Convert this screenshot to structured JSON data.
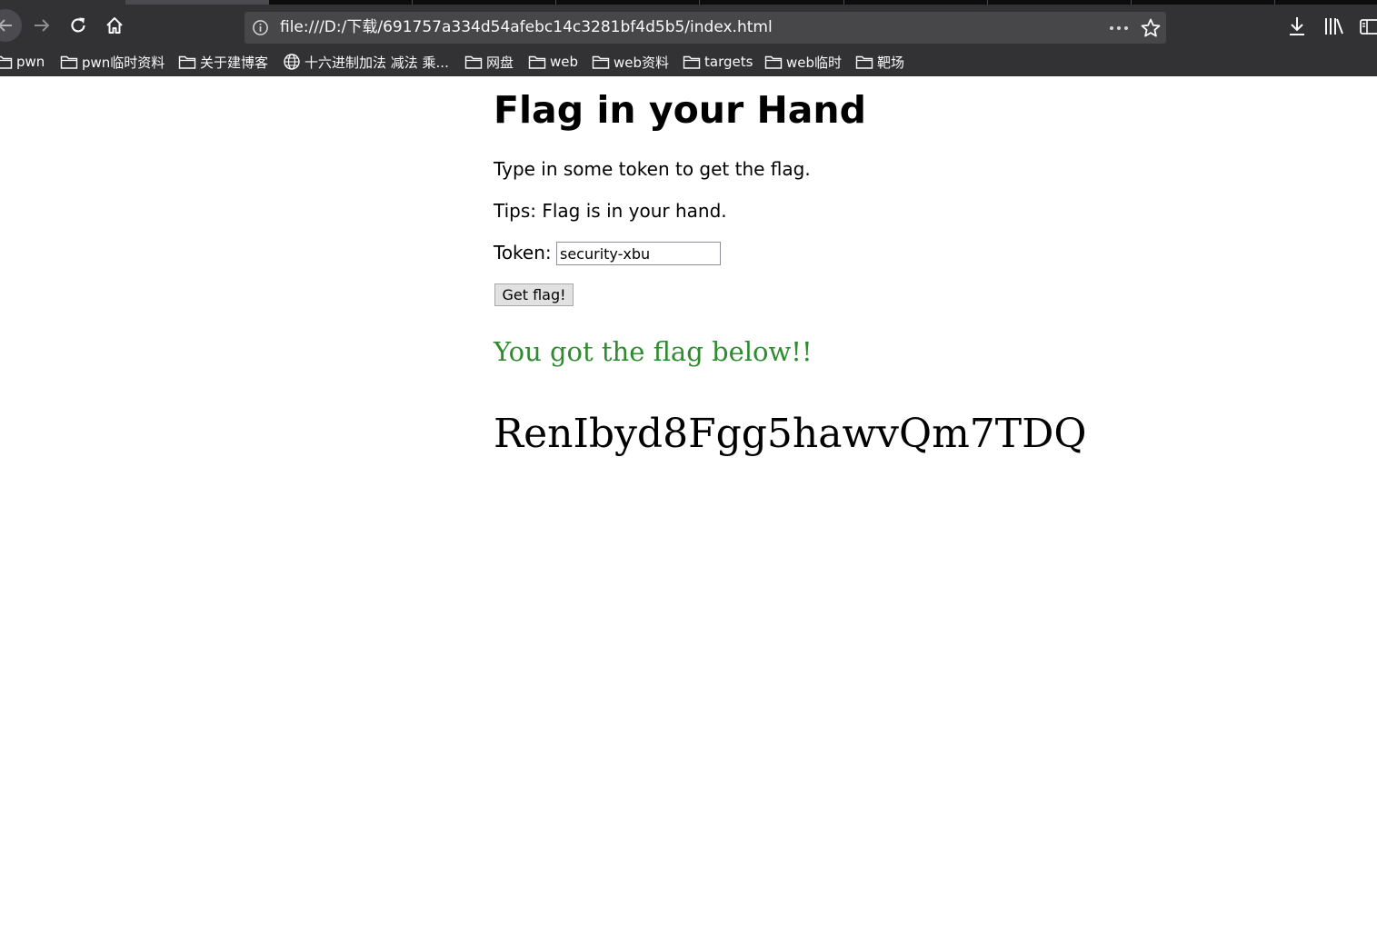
{
  "browser": {
    "url": "file:///D:/下载/691757a334d54afebc14c3281bf4d5b5/index.html",
    "bookmarks": [
      {
        "label": "pwn",
        "icon": "folder-icon"
      },
      {
        "label": "pwn临时资料",
        "icon": "folder-icon"
      },
      {
        "label": "关于建博客",
        "icon": "folder-icon"
      },
      {
        "label": "十六进制加法 减法 乘...",
        "icon": "globe-icon"
      },
      {
        "label": "网盘",
        "icon": "folder-icon"
      },
      {
        "label": "web",
        "icon": "folder-icon"
      },
      {
        "label": "web资料",
        "icon": "folder-icon"
      },
      {
        "label": "targets",
        "icon": "folder-icon"
      },
      {
        "label": "web临时",
        "icon": "folder-icon"
      },
      {
        "label": "靶场",
        "icon": "folder-icon"
      }
    ]
  },
  "page": {
    "title": "Flag in your Hand",
    "instruction": "Type in some token to get the flag.",
    "tips": "Tips: Flag is in your hand.",
    "token_label": "Token:",
    "token_value": "security-xbu",
    "button_label": "Get flag!",
    "success_message": "You got the flag below!!",
    "flag": "RenIbyd8Fgg5hawvQm7TDQ"
  },
  "colors": {
    "chrome_bg": "#323234",
    "urlbar_bg": "#474749",
    "success_text": "#2e8b2e"
  }
}
